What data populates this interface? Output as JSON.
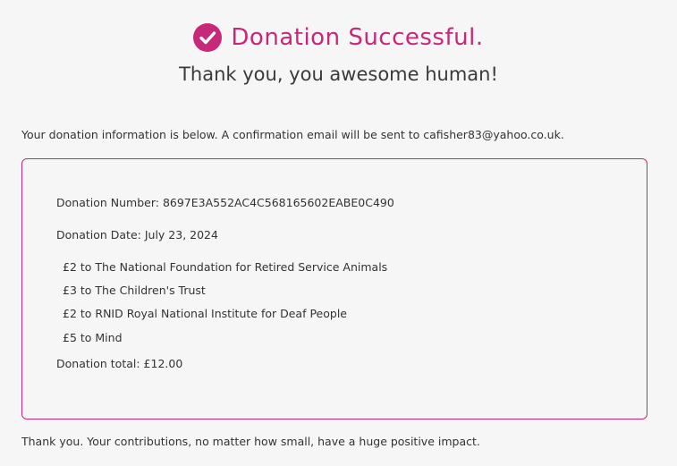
{
  "header": {
    "title": "Donation Successful.",
    "subtitle": "Thank you, you awesome human!",
    "icon": "check-circle-icon",
    "accent_color": "#c8287a"
  },
  "info_text": "Your donation information is below. A confirmation email will be sent to cafisher83@yahoo.co.uk.",
  "details": {
    "donation_number": "Donation Number: 8697E3A552AC4C568165602EABE0C490",
    "donation_date": "Donation Date: July 23, 2024",
    "items": [
      "£2 to The National Foundation for Retired Service Animals",
      "£3 to The Children's Trust",
      "£2 to RNID Royal National Institute for Deaf People",
      "£5 to Mind"
    ],
    "total": "Donation total: £12.00"
  },
  "footer_text": "Thank you. Your contributions, no matter how small, have a huge positive impact."
}
